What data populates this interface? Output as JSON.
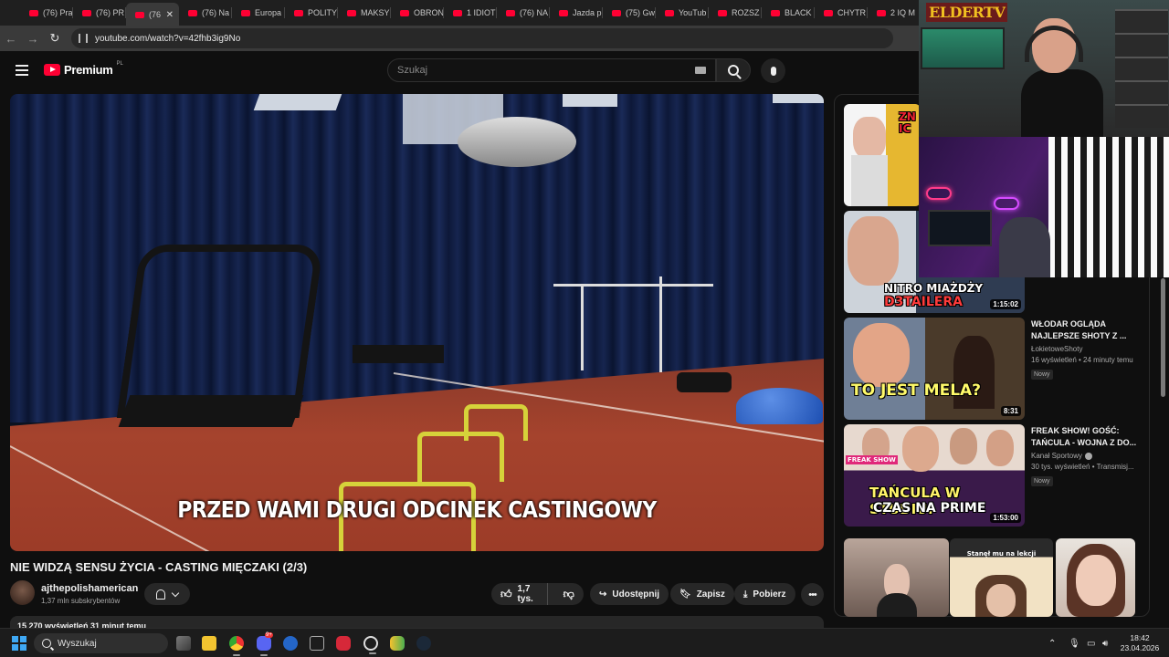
{
  "browser": {
    "tabs": [
      {
        "label": "(76) Pra",
        "active": false
      },
      {
        "label": "(76) PR",
        "active": false
      },
      {
        "label": "(76",
        "active": true
      },
      {
        "label": "(76) Na",
        "active": false
      },
      {
        "label": "Europa",
        "active": false
      },
      {
        "label": "POLITYK",
        "active": false
      },
      {
        "label": "MAKSY",
        "active": false
      },
      {
        "label": "OBRON",
        "active": false
      },
      {
        "label": "1 IDIOT",
        "active": false
      },
      {
        "label": "(76) NA",
        "active": false
      },
      {
        "label": "Jazda p",
        "active": false
      },
      {
        "label": "(75) Gw",
        "active": false
      },
      {
        "label": "YouTub",
        "active": false
      },
      {
        "label": "ROZSZ",
        "active": false
      },
      {
        "label": "BLACK",
        "active": false
      },
      {
        "label": "CHYTR",
        "active": false
      },
      {
        "label": "2 IQ M",
        "active": false
      }
    ],
    "close_glyph": "✕",
    "url": "youtube.com/watch?v=42fhb3ig9No"
  },
  "youtube": {
    "logo_word": "Premium",
    "logo_region": "PL",
    "search_placeholder": "Szukaj"
  },
  "video": {
    "subtitle": "PRZED WAMI DRUGI ODCINEK CASTINGOWY",
    "title": "NIE WIDZĄ SENSU ŻYCIA - CASTING MIĘCZAKI (2/3)",
    "channel_name": "ajthepolishamerican",
    "channel_subs": "1,37 mln subskrybentów",
    "likes": "1,7 tys.",
    "share_label": "Udostępnij",
    "save_label": "Zapisz",
    "download_label": "Pobierz",
    "more_glyph": "•••",
    "description_line": "15 270 wyświetleń  31 minut temu"
  },
  "suggestions": [
    {
      "thumb_text": "ZN IC",
      "duration": ""
    },
    {
      "thumb_text_1": "NITRO MIAŻDŻY",
      "thumb_text_2": "D3TAILERA",
      "duration": "1:15:02"
    },
    {
      "thumb_text": "TO JEST MELA?",
      "duration": "8:31",
      "title": "WŁODAR OGLĄDA NAJLEPSZE SHOTY Z ...",
      "channel": "ŁokietoweShoty",
      "stats": "16 wyświetleń • 24 minuty temu",
      "badge": "Nowy"
    },
    {
      "thumb_corner": "FREAK SHOW",
      "thumb_text_1": "TAŃCULA W STUDIU!",
      "thumb_text_2": "CZAS NA PRIME",
      "duration": "1:53:00",
      "title": "FREAK SHOW! GOŚĆ: TAŃCULA - WOJNA Z DO...",
      "channel": "Kanał Sportowy",
      "stats": "30 tys. wyświetleń • Transmisj...",
      "badge": "Nowy"
    },
    {
      "thumb_text": "Stanęł mu na lekcji",
      "duration": ""
    }
  ],
  "webcam": {
    "logo": "ELDERTV"
  },
  "taskbar": {
    "search_placeholder": "Wyszukaj",
    "discord_badge": "9+",
    "time": "18:42",
    "date": "23.04.2026"
  },
  "colors": {
    "yt_red": "#ff0033",
    "bg": "#0f0f0f",
    "pill": "#272727",
    "hurdle_yellow": "#d6d23a"
  }
}
